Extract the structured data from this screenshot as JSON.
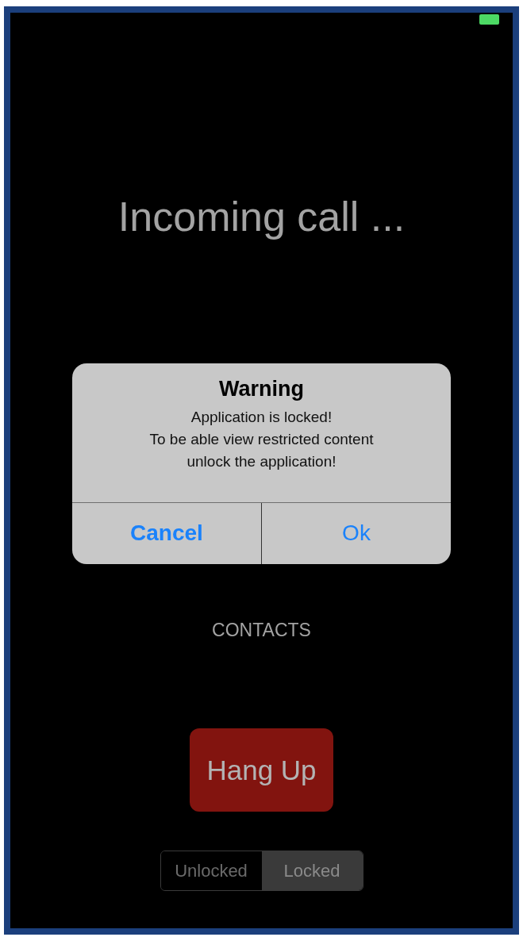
{
  "title": "Incoming call ...",
  "alert": {
    "title": "Warning",
    "message_lines": [
      "Application is locked!",
      "To be able view restricted content",
      "unlock the application!"
    ],
    "buttons": [
      {
        "label": "Cancel",
        "preferred": true
      },
      {
        "label": "Ok",
        "preferred": false
      }
    ]
  },
  "contacts_link": "CONTACTS",
  "hang_up_button": "Hang Up",
  "lock_segments": [
    {
      "label": "Unlocked",
      "selected": false
    },
    {
      "label": "Locked",
      "selected": true
    }
  ]
}
